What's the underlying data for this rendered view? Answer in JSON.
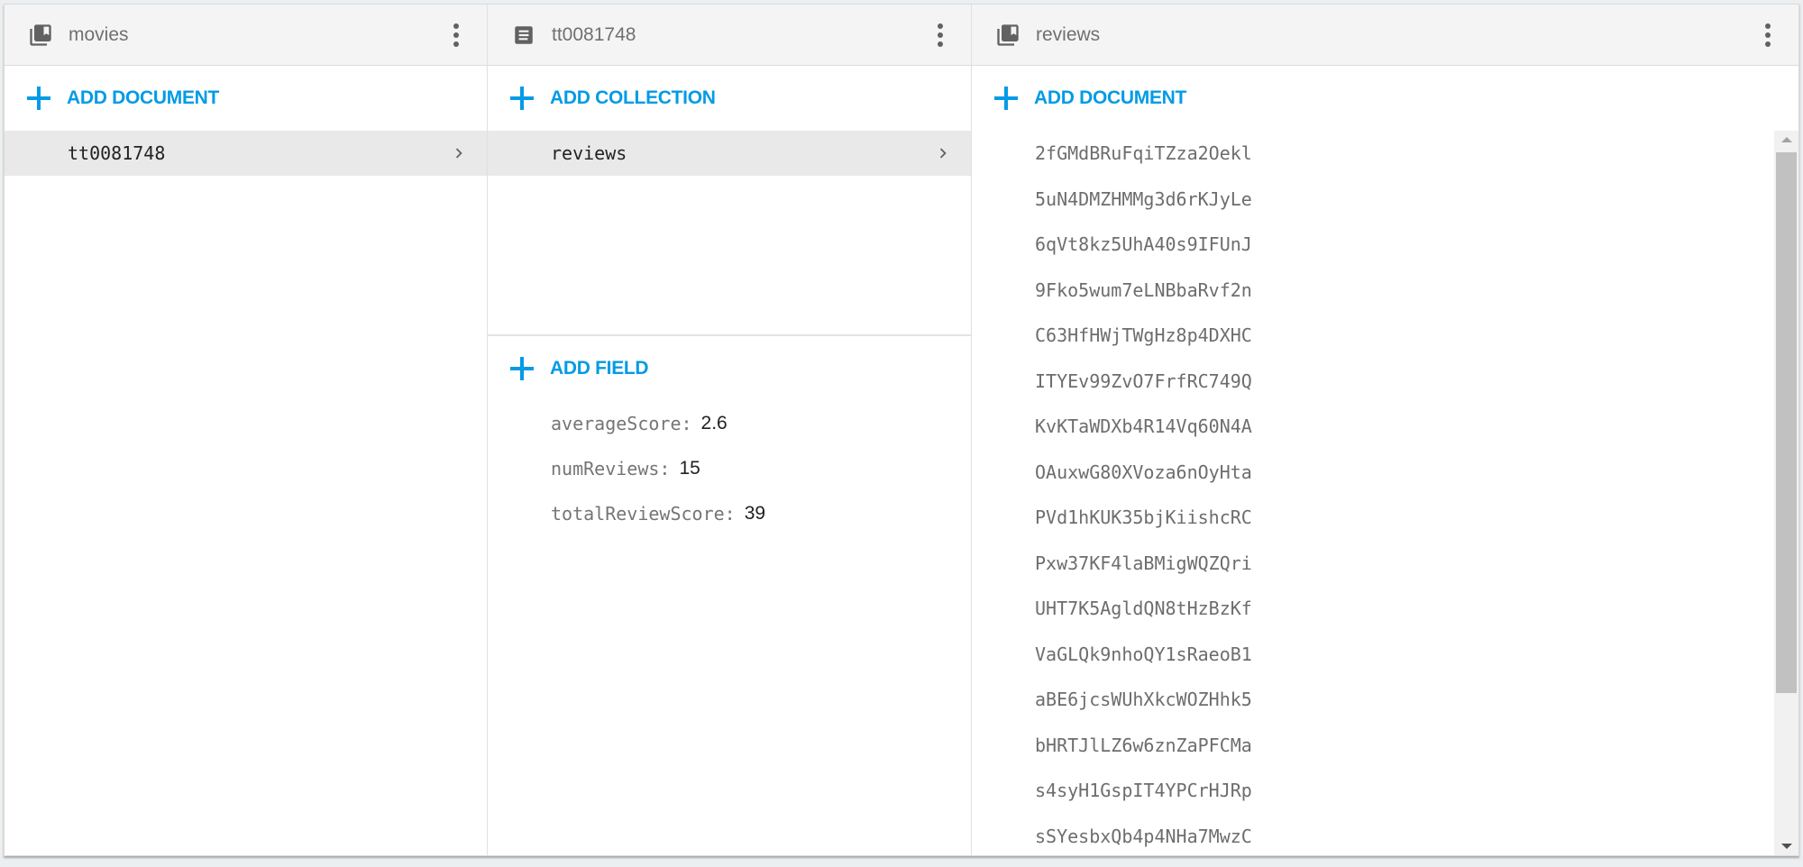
{
  "colors": {
    "accent": "#039be5",
    "header_bg": "#f4f4f4",
    "selected_bg": "#e9e9e9"
  },
  "panels": [
    {
      "title": "movies",
      "icon": "collection-icon",
      "add_label": "ADD DOCUMENT",
      "items": [
        {
          "label": "tt0081748",
          "selected": true
        }
      ]
    },
    {
      "title": "tt0081748",
      "icon": "document-icon",
      "add_collection_label": "ADD COLLECTION",
      "collections": [
        {
          "label": "reviews",
          "selected": true
        }
      ],
      "add_field_label": "ADD FIELD",
      "fields": [
        {
          "key": "averageScore",
          "value": "2.6"
        },
        {
          "key": "numReviews",
          "value": "15"
        },
        {
          "key": "totalReviewScore",
          "value": "39"
        }
      ]
    },
    {
      "title": "reviews",
      "icon": "collection-icon",
      "add_label": "ADD DOCUMENT",
      "items": [
        "2fGMdBRuFqiTZza2Oekl",
        "5uN4DMZHMMg3d6rKJyLe",
        "6qVt8kz5UhA40s9IFUnJ",
        "9Fko5wum7eLNBbaRvf2n",
        "C63HfHWjTWgHz8p4DXHC",
        "ITYEv99ZvO7FrfRC749Q",
        "KvKTaWDXb4R14Vq60N4A",
        "OAuxwG80XVoza6nOyHta",
        "PVd1hKUK35bjKiishcRC",
        "Pxw37KF4laBMigWQZQri",
        "UHT7K5AgldQN8tHzBzKf",
        "VaGLQk9nhoQY1sRaeoB1",
        "aBE6jcsWUhXkcWOZHhk5",
        "bHRTJlLZ6w6znZaPFCMa",
        "s4syH1GspIT4YPCrHJRp",
        "sSYesbxQb4p4NHa7MwzC"
      ]
    }
  ]
}
